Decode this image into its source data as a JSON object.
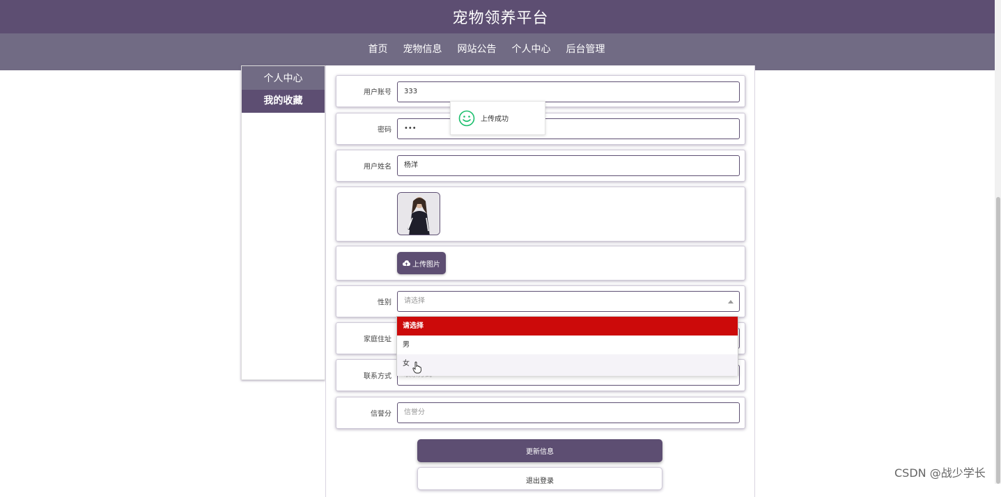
{
  "header": {
    "title": "宠物领养平台"
  },
  "nav": {
    "items": [
      {
        "label": "首页"
      },
      {
        "label": "宠物信息"
      },
      {
        "label": "网站公告"
      },
      {
        "label": "个人中心"
      },
      {
        "label": "后台管理"
      }
    ],
    "active_index": 3
  },
  "sidebar": {
    "items": [
      {
        "label": "个人中心"
      },
      {
        "label": "我的收藏"
      }
    ]
  },
  "form": {
    "account": {
      "label": "用户账号",
      "value": "333"
    },
    "password": {
      "label": "密码",
      "value": "•••"
    },
    "name": {
      "label": "用户姓名",
      "value": "杨洋"
    },
    "upload": {
      "label": "上传图片"
    },
    "gender": {
      "label": "性别",
      "placeholder": "请选择"
    },
    "address": {
      "label": "家庭住址"
    },
    "contact": {
      "label": "联系方式",
      "placeholder": "联系方式"
    },
    "credit": {
      "label": "信誉分",
      "placeholder": "信誉分"
    }
  },
  "dropdown": {
    "options": [
      "请选择",
      "男",
      "女"
    ],
    "selected_index": 0
  },
  "toast": {
    "message": "上传成功"
  },
  "buttons": {
    "update": "更新信息",
    "logout": "退出登录"
  },
  "watermark": "CSDN @战少学长",
  "colors": {
    "primary": "#5d4e72",
    "nav_bg": "#716b84",
    "selected_option": "#cc0a0a",
    "success": "#19be6b"
  }
}
